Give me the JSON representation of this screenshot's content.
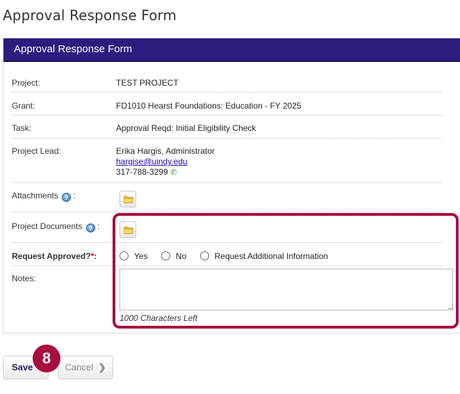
{
  "page": {
    "title": "Approval Response Form"
  },
  "panel": {
    "header": "Approval Response Form"
  },
  "fields": {
    "project": {
      "label": "Project:",
      "value": "TEST PROJECT"
    },
    "grant": {
      "label": "Grant:",
      "value": "FD1010 Hearst Foundations: Education - FY 2025"
    },
    "task": {
      "label": "Task:",
      "value": "Approval Reqd: Initial Eligibility Check"
    },
    "lead": {
      "label": "Project Lead:",
      "name": "Erika Hargis, Administrator",
      "email": "hargise@uindy.edu",
      "phone": "317-788-3299"
    },
    "attachments": {
      "label": "Attachments",
      "suffix": ":"
    },
    "documents": {
      "label": "Project Documents",
      "suffix": ":"
    },
    "approved": {
      "label": "Request Approved?",
      "required_mark": "*",
      "suffix": ":",
      "options": [
        "Yes",
        "No",
        "Request Additional Information"
      ]
    },
    "notes": {
      "label": "Notes:",
      "value": "",
      "chars_left": "1000 Characters Left"
    }
  },
  "actions": {
    "save_label": "Save",
    "cancel_label": "Cancel",
    "cancel_icon": "❯"
  },
  "annotation": {
    "step": "8",
    "color": "#a80f3e"
  },
  "colors": {
    "header_bg": "#2c1c7e",
    "accent": "#a80f3e"
  }
}
